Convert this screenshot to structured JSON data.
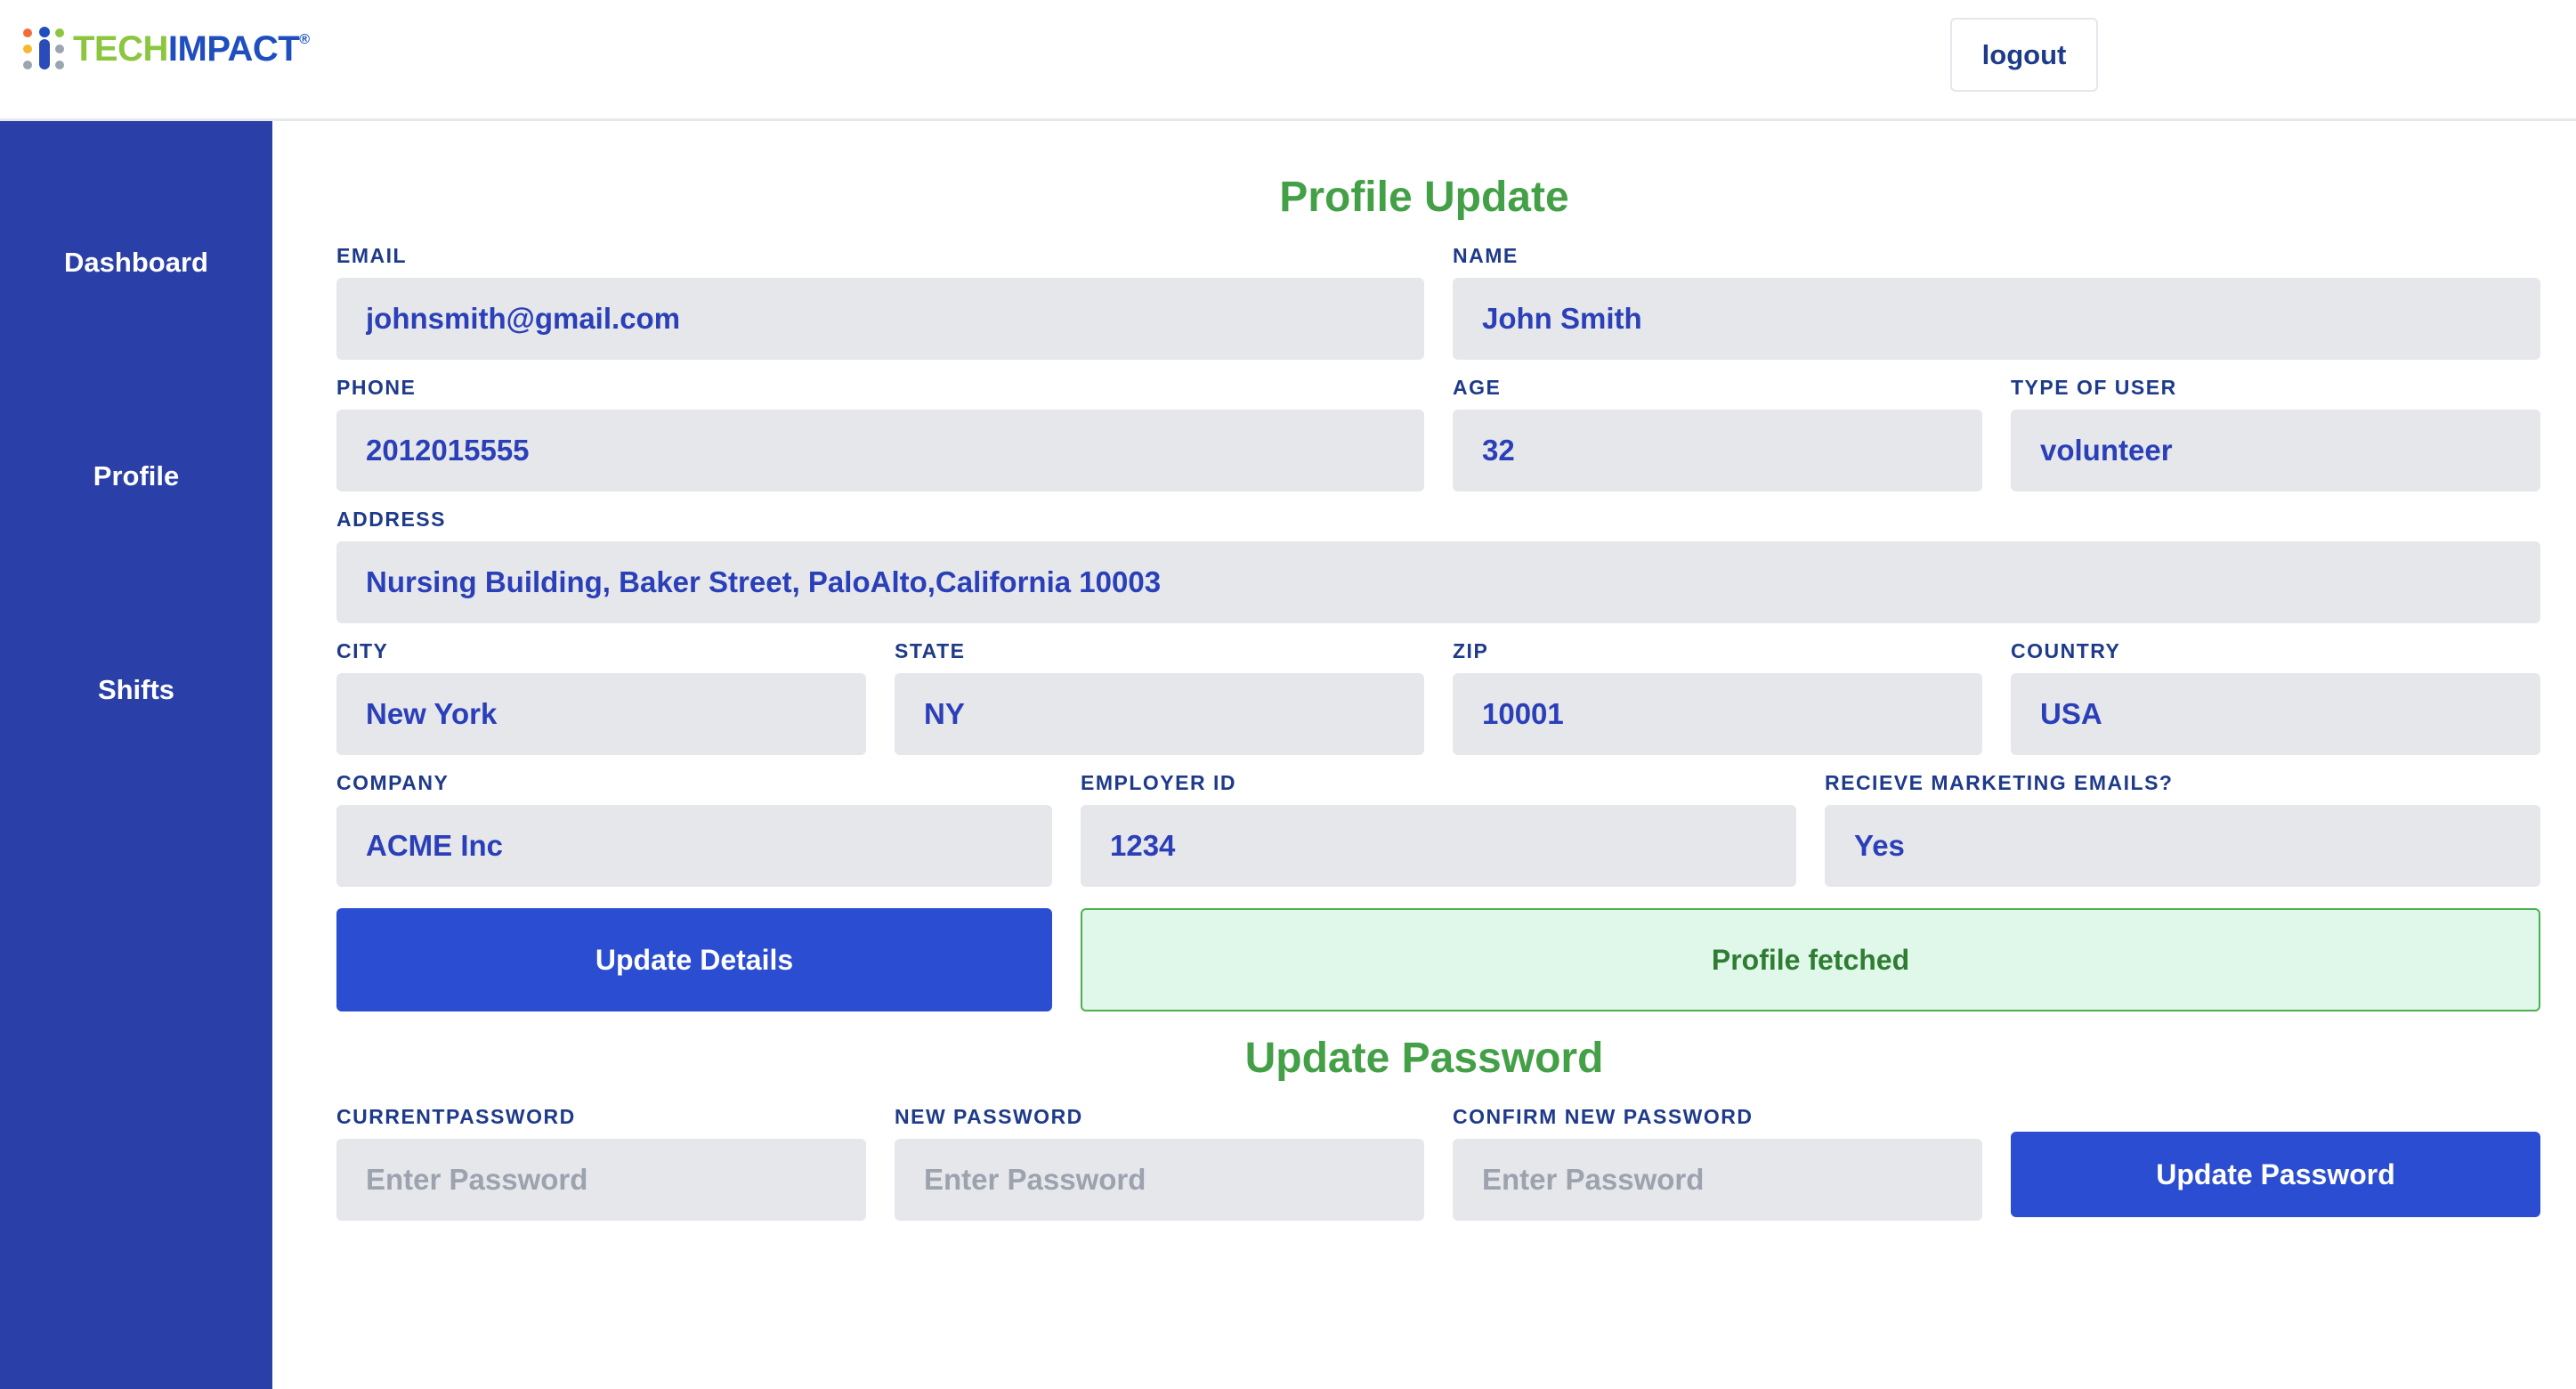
{
  "brand": {
    "logo_tech": "TECH",
    "logo_impact": "IMPACT",
    "logo_reg": "®",
    "colors": {
      "tech": "#8cc63f",
      "impact": "#1f4fbf"
    }
  },
  "header": {
    "logout_label": "logout"
  },
  "sidebar": {
    "items": [
      {
        "label": "Dashboard"
      },
      {
        "label": "Profile"
      },
      {
        "label": "Shifts"
      }
    ]
  },
  "profile": {
    "title": "Profile Update",
    "fields": {
      "email": {
        "label": "EMAIL",
        "value": "johnsmith@gmail.com"
      },
      "name": {
        "label": "NAME",
        "value": "John Smith"
      },
      "phone": {
        "label": "PHONE",
        "value": "2012015555"
      },
      "age": {
        "label": "AGE",
        "value": "32"
      },
      "type_of_user": {
        "label": "TYPE OF USER",
        "value": "volunteer"
      },
      "address": {
        "label": "ADDRESS",
        "value": "Nursing Building, Baker Street, PaloAlto,California 10003"
      },
      "city": {
        "label": "CITY",
        "value": "New York"
      },
      "state": {
        "label": "STATE",
        "value": "NY"
      },
      "zip": {
        "label": "ZIP",
        "value": "10001"
      },
      "country": {
        "label": "COUNTRY",
        "value": "USA"
      },
      "company": {
        "label": "COMPANY",
        "value": "ACME Inc"
      },
      "employer_id": {
        "label": "EMPLOYER ID",
        "value": "1234"
      },
      "marketing": {
        "label": "RECIEVE MARKETING EMAILS?",
        "value": "Yes"
      }
    },
    "update_button": "Update Details",
    "status_message": "Profile fetched"
  },
  "password": {
    "title": "Update Password",
    "fields": {
      "current": {
        "label": "CURRENTPASSWORD",
        "placeholder": "Enter Password"
      },
      "new": {
        "label": "NEW PASSWORD",
        "placeholder": "Enter Password"
      },
      "confirm": {
        "label": "CONFIRM NEW PASSWORD",
        "placeholder": "Enter Password"
      }
    },
    "update_button": "Update Password"
  },
  "colors": {
    "sidebar": "#2a3fa7",
    "primary_button": "#2b4dd1",
    "title_green": "#43a047",
    "status_bg": "#e0f8ea",
    "input_bg": "#e5e7eb"
  }
}
